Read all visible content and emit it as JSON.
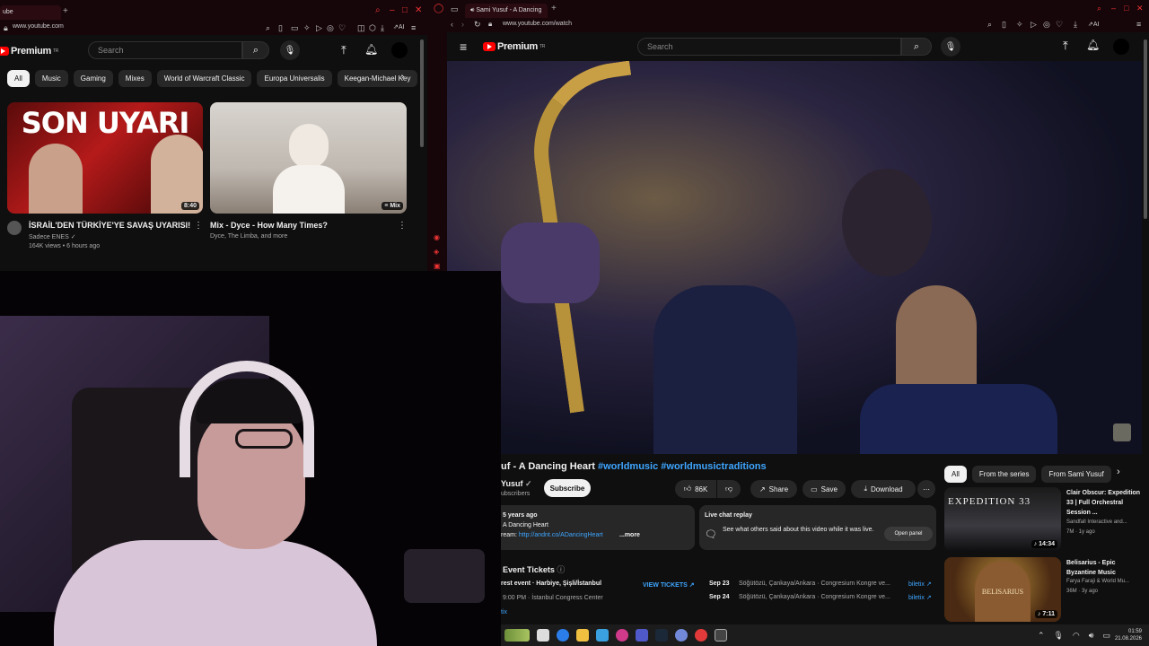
{
  "left_browser": {
    "tab_label": "ube",
    "url": "www.youtube.com",
    "logo": "Premium",
    "logo_sup": "TR",
    "search_placeholder": "Search",
    "chips": [
      "All",
      "Music",
      "Gaming",
      "Mixes",
      "World of Warcraft Classic",
      "Europa Universalis",
      "Keegan-Michael Key"
    ],
    "videos": [
      {
        "thumb_text": "SON UYARI",
        "duration": "8:40",
        "title": "İSRAİL'DEN TÜRKİYE'YE SAVAŞ UYARISI!",
        "channel": "Sadece ENES",
        "meta": "164K views • 6 hours ago"
      },
      {
        "duration": "Mix",
        "title": "Mix - Dyce - How Many Times?",
        "channel": "Dyce, The Limba, and more"
      }
    ]
  },
  "right_browser": {
    "tab_label": "Sami Yusuf - A Dancing",
    "url": "www.youtube.com/watch",
    "logo": "Premium",
    "logo_sup": "TR",
    "search_placeholder": "Search",
    "video_title": "uf - A Dancing Heart",
    "hashtags": "#worldmusic #worldmusictraditions",
    "channel_name": "Yusuf",
    "subscribers": "ubscribers",
    "subscribe_label": "Subscribe",
    "likes": "86K",
    "share_label": "Share",
    "save_label": "Save",
    "download_label": "Download",
    "desc_date": "5 years ago",
    "desc_line1": "A Dancing Heart",
    "desc_line2_prefix": "ream: ",
    "desc_link": "http://andnt.co/ADancingHeart",
    "desc_more": "...more",
    "live_chat_title": "Live chat replay",
    "live_chat_text": "See what others said about this video while it was live.",
    "open_panel_label": "Open panel",
    "events_title": "Event Tickets",
    "event1_name": "rest event · Harbiye, Şişli/İstanbul",
    "event1_time": "9:00 PM · İstanbul Congress Center",
    "view_tickets_label": "VIEW TICKETS",
    "events": [
      {
        "date": "Sep 23",
        "venue": "Söğütözü, Çankaya/Ankara · Congresium Kongre ve...",
        "seller": "biletix"
      },
      {
        "date": "Sep 24",
        "venue": "Söğütözü, Çankaya/Ankara · Congresium Kongre ve...",
        "seller": "biletix"
      }
    ],
    "tix_label": "tix",
    "rec_chips": [
      "All",
      "From the series",
      "From Sami Yusuf"
    ],
    "recommendations": [
      {
        "thumb_text": "EXPEDITION 33",
        "duration": "14:34",
        "title": "Clair Obscur: Expedition 33 | Full Orchestral Session ...",
        "channel": "Sandfall Interactive and...",
        "meta": "7M · 1y ago"
      },
      {
        "thumb_text": "BELISARIUS",
        "duration": "7:11",
        "title": "Belisarius - Epic Byzantine Music",
        "channel": "Farya Faraji & World Mu...",
        "meta": "36M · 3y ago"
      }
    ]
  },
  "taskbar": {
    "time": "01:59",
    "date": "21.08.2026"
  },
  "colors": {
    "accent": "#ff0000",
    "link": "#3ea6ff",
    "tabbar": "#16060a",
    "bg": "#0f0f0f"
  }
}
